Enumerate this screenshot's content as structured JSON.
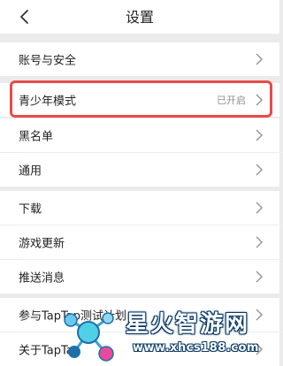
{
  "header": {
    "title": "设置",
    "back_icon": "back-chevron-icon"
  },
  "rows": [
    {
      "label": "账号与安全"
    },
    {
      "label": "青少年模式",
      "status": "已开启"
    },
    {
      "label": "黑名单"
    },
    {
      "label": "通用"
    },
    {
      "label": "下载"
    },
    {
      "label": "游戏更新"
    },
    {
      "label": "推送消息"
    },
    {
      "label": "参与TapTap测试计划"
    },
    {
      "label": "关于TapTap"
    }
  ],
  "colors": {
    "background": "#ebebeb",
    "row": "#ffffff",
    "highlight": "#e84a4a",
    "text": "#222222",
    "muted": "#8f8f8f"
  },
  "watermark": {
    "brand": "星火智游网",
    "url": "www.xhcs188.com"
  }
}
